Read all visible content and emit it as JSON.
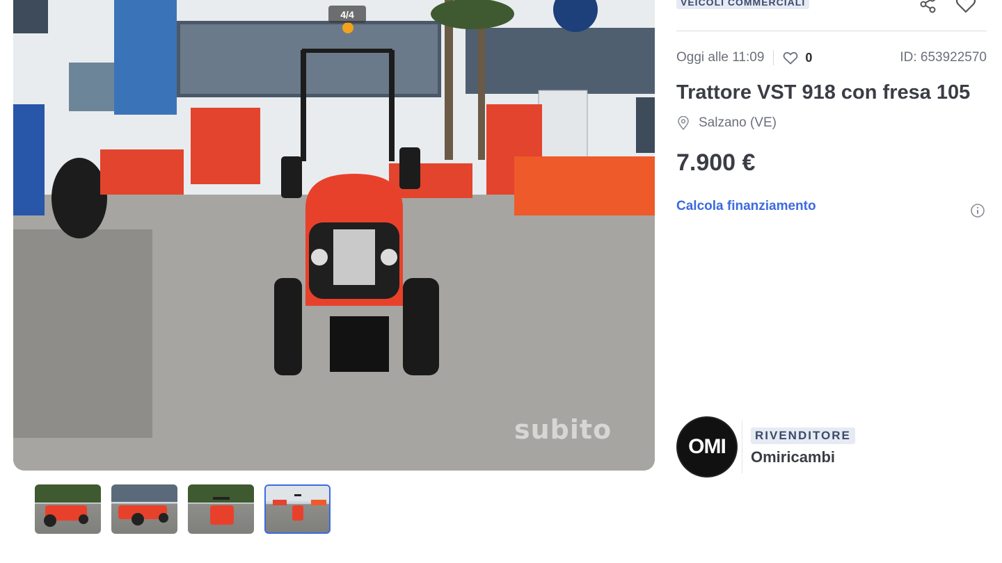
{
  "gallery": {
    "counter": "4/4",
    "watermark": "subito",
    "thumbnails": [
      {
        "label": "photo-1",
        "active": false
      },
      {
        "label": "photo-2",
        "active": false
      },
      {
        "label": "photo-3",
        "active": false
      },
      {
        "label": "photo-4",
        "active": true
      }
    ]
  },
  "listing": {
    "category": "VEICOLI COMMERCIALI",
    "posted": "Oggi alle 11:09",
    "favorites_count": "0",
    "ad_id": "ID: 653922570",
    "title": "Trattore VST 918 con fresa 105",
    "location": "Salzano (VE)",
    "price": "7.900 €",
    "finance_link": "Calcola finanziamento"
  },
  "seller": {
    "logo_text": "OMI",
    "type_badge": "RIVENDITORE",
    "name": "Omiricambi"
  },
  "icons": {
    "share": "share-icon",
    "favorite": "heart-icon",
    "location": "pin-icon",
    "info": "info-icon"
  },
  "colors": {
    "accent": "#3c6adf",
    "badge_bg": "#e6eaf3",
    "tractor": "#e8412b"
  }
}
